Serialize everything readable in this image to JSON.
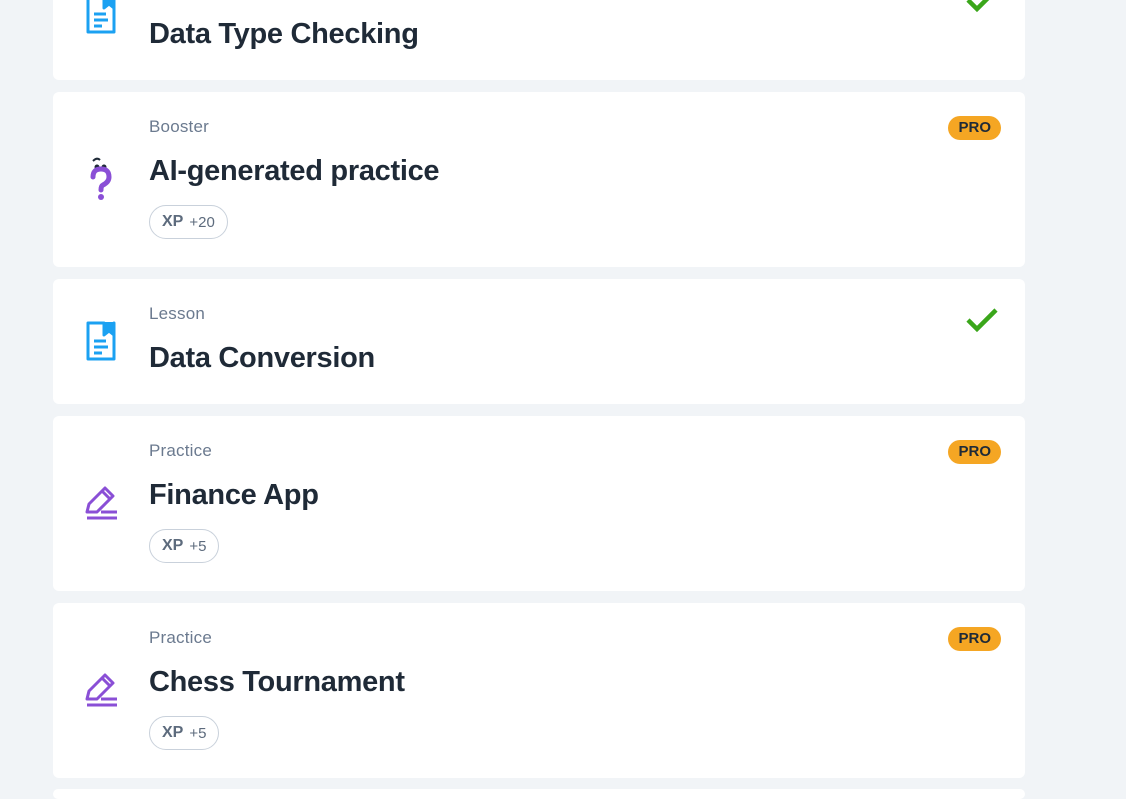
{
  "items": [
    {
      "type": "",
      "title": "Data Type Checking",
      "kind": "lesson",
      "completed": true,
      "pro": false
    },
    {
      "type": "Booster",
      "title": "AI-generated practice",
      "kind": "booster",
      "pro": true,
      "pro_label": "PRO",
      "xp_label": "XP",
      "xp_value": "+20"
    },
    {
      "type": "Lesson",
      "title": "Data Conversion",
      "kind": "lesson",
      "completed": true,
      "pro": false
    },
    {
      "type": "Practice",
      "title": "Finance App",
      "kind": "practice",
      "pro": true,
      "pro_label": "PRO",
      "xp_label": "XP",
      "xp_value": "+5"
    },
    {
      "type": "Practice",
      "title": "Chess Tournament",
      "kind": "practice",
      "pro": true,
      "pro_label": "PRO",
      "xp_label": "XP",
      "xp_value": "+5"
    }
  ],
  "colors": {
    "lesson_icon": "#1ba1f2",
    "practice_icon": "#8a4fd6",
    "check": "#3aa61a",
    "pro_badge": "#f5a623"
  },
  "icons": {
    "lesson": "document-icon",
    "booster": "question-mark-icon",
    "practice": "pencil-icon",
    "completed": "checkmark-icon"
  }
}
